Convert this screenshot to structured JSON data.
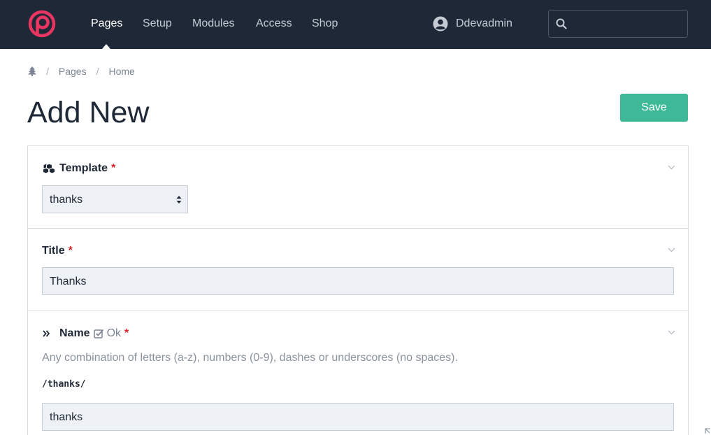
{
  "nav": {
    "items": [
      {
        "label": "Pages",
        "active": true
      },
      {
        "label": "Setup",
        "active": false
      },
      {
        "label": "Modules",
        "active": false
      },
      {
        "label": "Access",
        "active": false
      },
      {
        "label": "Shop",
        "active": false
      }
    ],
    "user_name": "Ddevadmin",
    "search_value": ""
  },
  "breadcrumb": {
    "home_icon": "tree-icon",
    "items": [
      "Pages",
      "Home"
    ],
    "separator": "/"
  },
  "page": {
    "title": "Add New",
    "save_label": "Save"
  },
  "form": {
    "template": {
      "icon": "cubes-icon",
      "label": "Template",
      "required_mark": "*",
      "value": "thanks"
    },
    "title": {
      "label": "Title",
      "required_mark": "*",
      "value": "Thanks"
    },
    "name": {
      "icon": "angle-double-right-icon",
      "label": "Name",
      "status_icon": "check-square-icon",
      "status_text": "Ok",
      "required_mark": "*",
      "description": "Any combination of letters (a-z), numbers (0-9), dashes or underscores (no spaces).",
      "path": "/thanks/",
      "value": "thanks"
    }
  },
  "colors": {
    "topbar": "#1e2836",
    "brand": "#e83561",
    "save_button": "#3eb998",
    "required": "#d9232d",
    "input_bg": "#eef1f6"
  }
}
